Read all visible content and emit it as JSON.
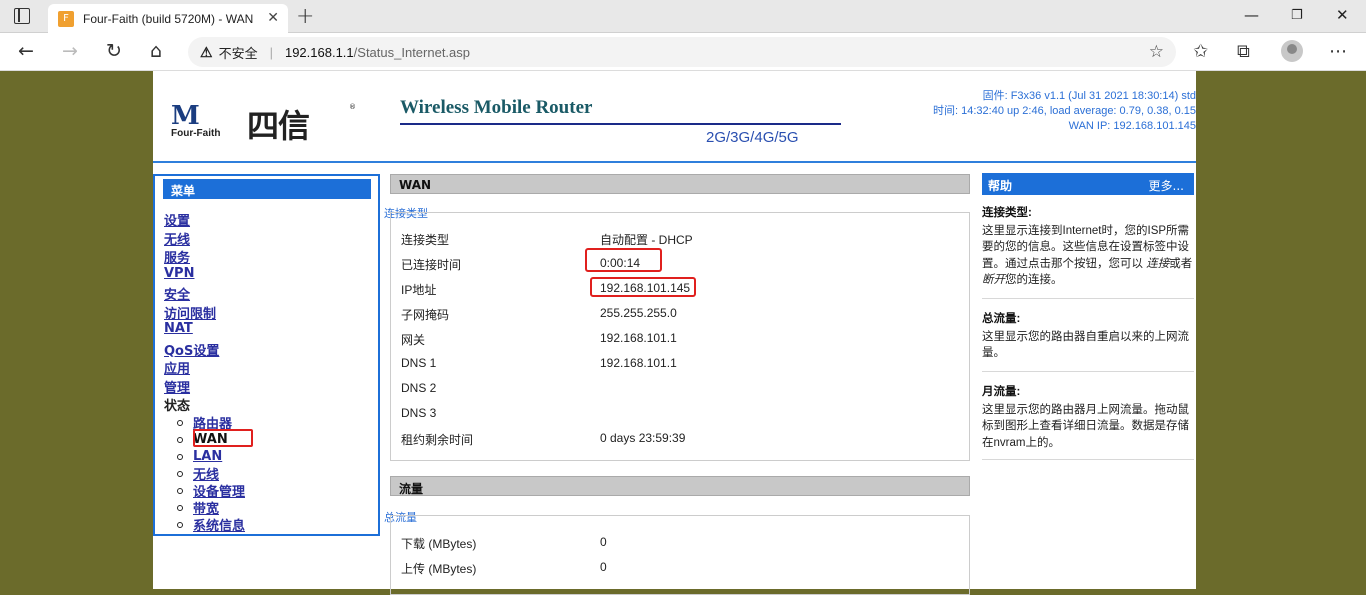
{
  "browser": {
    "tab_title": "Four-Faith (build 5720M) - WAN",
    "security_label": "不安全",
    "url_host": "192.168.1.1",
    "url_path": "/Status_Internet.asp"
  },
  "header": {
    "logo_text": "Four-Faith",
    "logo_cn": "四信",
    "product_title": "Wireless Mobile Router",
    "product_bands": "2G/3G/4G/5G",
    "firmware": "固件: F3x36 v1.1 (Jul 31 2021 18:30:14) std",
    "time": "时间: 14:32:40 up 2:46, load average: 0.79, 0.38, 0.15",
    "wan_ip": "WAN IP: 192.168.101.145"
  },
  "menu": {
    "title": "菜单",
    "items": [
      "设置",
      "无线",
      "服务",
      "VPN",
      "安全",
      "访问限制",
      "NAT",
      "QoS设置",
      "应用",
      "管理"
    ],
    "status_label": "状态",
    "submenu": [
      "路由器",
      "WAN",
      "LAN",
      "无线",
      "设备管理",
      "带宽",
      "系统信息"
    ],
    "current_submenu": "WAN"
  },
  "wan": {
    "section_title": "WAN",
    "legend": "连接类型",
    "rows": [
      {
        "label": "连接类型",
        "value": "自动配置 - DHCP"
      },
      {
        "label": "已连接时间",
        "value": "0:00:14"
      },
      {
        "label": "IP地址",
        "value": "192.168.101.145"
      },
      {
        "label": "子网掩码",
        "value": "255.255.255.0"
      },
      {
        "label": "网关",
        "value": "192.168.101.1"
      },
      {
        "label": "DNS 1",
        "value": "192.168.101.1"
      },
      {
        "label": "DNS 2",
        "value": ""
      },
      {
        "label": "DNS 3",
        "value": ""
      },
      {
        "label": "租约剩余时间",
        "value": "0 days 23:59:39"
      }
    ]
  },
  "traffic": {
    "section_title": "流量",
    "legend": "总流量",
    "rows": [
      {
        "label": "下载 (MBytes)",
        "value": "0"
      },
      {
        "label": "上传 (MBytes)",
        "value": "0"
      }
    ]
  },
  "help": {
    "title": "帮助",
    "more": "更多...",
    "blocks": [
      {
        "heading": "连接类型:",
        "text_a": "这里显示连接到Internet时，您的ISP所需要的您的信息。这些信息在设置标签中设置。通过点击那个按钮，您可以 ",
        "em1": "连接",
        "mid": "或者 ",
        "em2": "断开",
        "tail": "您的连接。"
      },
      {
        "heading": "总流量:",
        "text": "这里显示您的路由器自重启以来的上网流量。"
      },
      {
        "heading": "月流量:",
        "text": "这里显示您的路由器月上网流量。拖动鼠标到图形上查看详细日流量。数据是存储在nvram上的。"
      }
    ]
  }
}
